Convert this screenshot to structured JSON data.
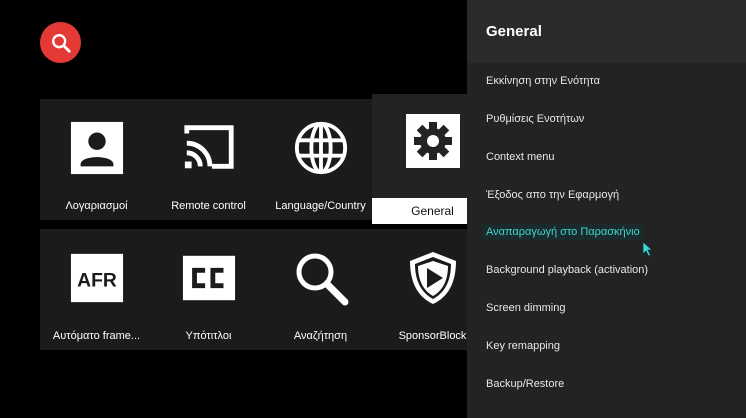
{
  "panel": {
    "title": "General",
    "items": [
      {
        "label": "Εκκίνηση στην Ενότητα"
      },
      {
        "label": "Ρυθμίσεις Ενοτήτων"
      },
      {
        "label": "Context menu"
      },
      {
        "label": "Έξοδος απο την Εφαρμογή"
      },
      {
        "label": "Αναπαραγωγή στο Παρασκήνιο"
      },
      {
        "label": "Background playback (activation)"
      },
      {
        "label": "Screen dimming"
      },
      {
        "label": "Key remapping"
      },
      {
        "label": "Backup/Restore"
      }
    ],
    "focused_index": 4
  },
  "tiles": [
    {
      "label": "Λογαριασμοί",
      "icon": "account-icon"
    },
    {
      "label": "Remote control",
      "icon": "cast-icon"
    },
    {
      "label": "Language/Country",
      "icon": "globe-icon"
    },
    {
      "label": "General",
      "icon": "gear-icon"
    },
    {
      "label": "Αυτόματο frame...",
      "icon": "afr-icon"
    },
    {
      "label": "Υπότιτλοι",
      "icon": "closed-captions-icon"
    },
    {
      "label": "Αναζήτηση",
      "icon": "search-icon"
    },
    {
      "label": "SponsorBlock",
      "icon": "sponsorblock-icon"
    }
  ],
  "colors": {
    "accent": "#e53935",
    "focus_text": "#3fd8d0",
    "panel_bg": "#232323",
    "tile_bg": "#1b1b1b"
  }
}
